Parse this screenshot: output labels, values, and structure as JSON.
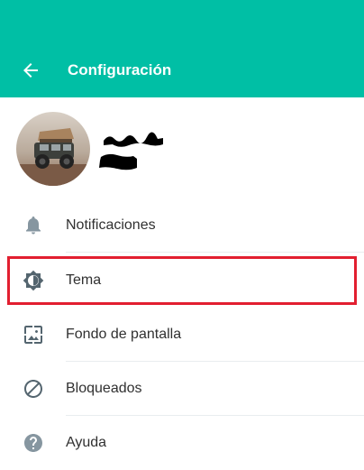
{
  "header": {
    "back_icon": "arrow-left-icon",
    "title": "Configuración",
    "background_color": "#00bfa5"
  },
  "profile": {
    "avatar_icon": "profile-photo"
  },
  "menu": {
    "items": [
      {
        "label": "Notificaciones",
        "icon": "bell-icon"
      },
      {
        "label": "Tema",
        "icon": "theme-icon"
      },
      {
        "label": "Fondo de pantalla",
        "icon": "wallpaper-icon"
      },
      {
        "label": "Bloqueados",
        "icon": "blocked-icon"
      },
      {
        "label": "Ayuda",
        "icon": "help-icon"
      }
    ]
  },
  "highlight_color": "#e21f30"
}
